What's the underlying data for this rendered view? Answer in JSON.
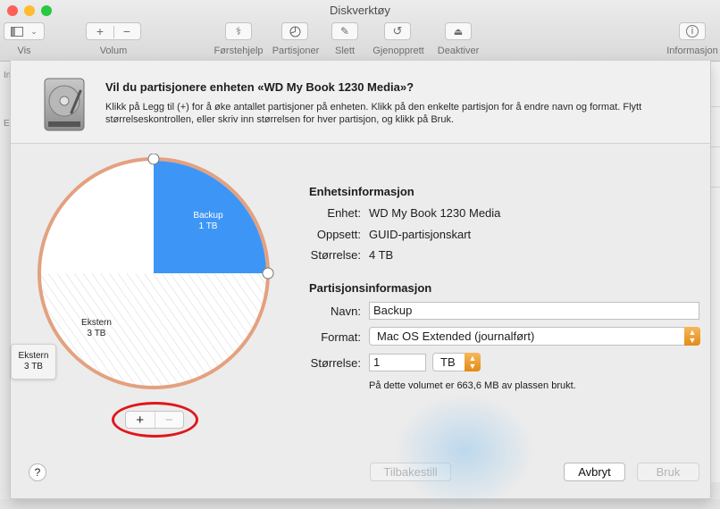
{
  "window": {
    "title": "Diskverktøy"
  },
  "toolbar": {
    "vis": "Vis",
    "volum": "Volum",
    "plus": "+",
    "minus": "−",
    "forstehjelp": "Førstehjelp",
    "partisjoner": "Partisjoner",
    "slett": "Slett",
    "gjenopprett": "Gjenopprett",
    "deaktiver": "Deaktiver",
    "informasjon": "Informasjon"
  },
  "sidebar_fragments": [
    "In",
    "E"
  ],
  "sheet": {
    "title": "Vil du partisjonere enheten «WD My Book 1230 Media»?",
    "description": "Klikk på Legg til (+) for å øke antallet partisjoner på enheten. Klikk på den enkelte partisjon for å endre navn og format. Flytt størrelseskontrollen, eller skriv inn størrelsen for hver partisjon, og klikk på Bruk."
  },
  "pie": {
    "partitions": [
      {
        "name": "Backup",
        "size": "1 TB",
        "fraction": 0.25,
        "color": "#3d96f5"
      },
      {
        "name": "Ekstern",
        "size": "3 TB",
        "fraction": 0.75,
        "color": "#ffffff"
      }
    ],
    "ring_color": "#e3a17f",
    "tooltip": {
      "name": "Ekstern",
      "size": "3 TB"
    }
  },
  "controls": {
    "add": "+",
    "remove": "−"
  },
  "device_info": {
    "heading": "Enhetsinformasjon",
    "rows": [
      {
        "label": "Enhet:",
        "value": "WD My Book 1230 Media"
      },
      {
        "label": "Oppsett:",
        "value": "GUID-partisjonskart"
      },
      {
        "label": "Størrelse:",
        "value": "4 TB"
      }
    ]
  },
  "partition_info": {
    "heading": "Partisjonsinformasjon",
    "name_label": "Navn:",
    "name_value": "Backup",
    "format_label": "Format:",
    "format_value": "Mac OS Extended (journalført)",
    "size_label": "Størrelse:",
    "size_value": "1",
    "unit_value": "TB",
    "usage_note": "På dette volumet er 663,6 MB av plassen brukt."
  },
  "buttons": {
    "help": "?",
    "revert": "Tilbakestill",
    "cancel": "Avbryt",
    "apply": "Bruk"
  },
  "colors": {
    "accent_orange": "#e48a16",
    "selection_blue": "#3d96f5",
    "highlight_ring": "#e0161b"
  }
}
